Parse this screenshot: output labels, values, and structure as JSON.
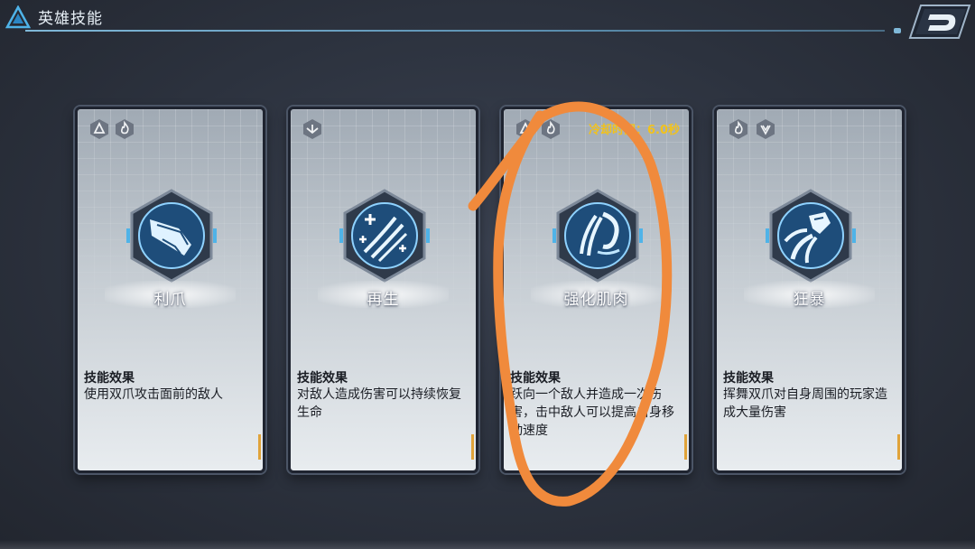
{
  "header": {
    "title": "英雄技能",
    "logo_icon": "triangle-logo-icon",
    "back_icon": "back-arrow-icon"
  },
  "cards": [
    {
      "name": "利爪",
      "tags": [
        "mountain-tag-icon",
        "flame-tag-icon"
      ],
      "icon": "claw-gauntlet-icon",
      "effect_heading": "技能效果",
      "effect_text": "使用双爪攻击面前的敌人"
    },
    {
      "name": "再生",
      "tags": [
        "regen-tag-icon"
      ],
      "icon": "claw-heal-icon",
      "effect_heading": "技能效果",
      "effect_text": "对敌人造成伤害可以持续恢复生命"
    },
    {
      "name": "强化肌肉",
      "tags": [
        "mountain-tag-icon",
        "flame-tag-icon"
      ],
      "icon": "claw-dash-icon",
      "cooldown": "冷却时间：6.0秒",
      "effect_heading": "技能效果",
      "effect_text": "跃向一个敌人并造成一次伤害，击中敌人可以提高自身移动速度"
    },
    {
      "name": "狂暴",
      "tags": [
        "flame-tag-icon",
        "shield-tag-icon"
      ],
      "icon": "claw-whirl-icon",
      "effect_heading": "技能效果",
      "effect_text": "挥舞双爪对自身周围的玩家造成大量伤害"
    }
  ],
  "colors": {
    "accent": "#7fb8d8",
    "cooldown": "#f2c21b",
    "annotation": "#f08a3c"
  }
}
